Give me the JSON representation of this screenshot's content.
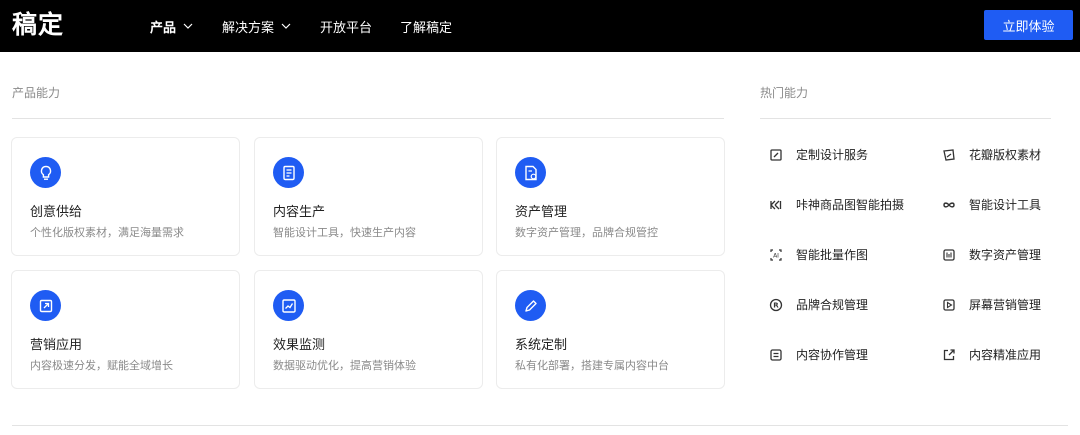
{
  "header": {
    "logo": "稿定",
    "nav": [
      {
        "label": "产品",
        "dropdown": true,
        "active": true
      },
      {
        "label": "解决方案",
        "dropdown": true,
        "active": false
      },
      {
        "label": "开放平台",
        "dropdown": false,
        "active": false
      },
      {
        "label": "了解稿定",
        "dropdown": false,
        "active": false
      }
    ],
    "cta_label": "立即体验"
  },
  "colors": {
    "brand": "#1f5cf3",
    "header_bg": "#000000"
  },
  "capabilities": {
    "title": "产品能力",
    "cards": [
      {
        "title": "创意供给",
        "desc": "个性化版权素材，满足海量需求",
        "icon": "lightbulb-icon"
      },
      {
        "title": "内容生产",
        "desc": "智能设计工具，快速生产内容",
        "icon": "document-icon"
      },
      {
        "title": "资产管理",
        "desc": "数字资产管理，品牌合规管控",
        "icon": "asset-file-icon"
      },
      {
        "title": "营销应用",
        "desc": "内容极速分发，赋能全域增长",
        "icon": "external-link-icon"
      },
      {
        "title": "效果监测",
        "desc": "数据驱动优化，提高营销体验",
        "icon": "trend-chart-icon"
      },
      {
        "title": "系统定制",
        "desc": "私有化部署，搭建专属内容中台",
        "icon": "pen-edit-icon"
      }
    ]
  },
  "hot": {
    "title": "热门能力",
    "items": [
      {
        "label": "定制设计服务",
        "icon": "custom-design-icon"
      },
      {
        "label": "花瓣版权素材",
        "icon": "petal-icon"
      },
      {
        "label": "咔神商品图智能拍摄",
        "icon": "camera-shoot-icon"
      },
      {
        "label": "智能设计工具",
        "icon": "infinity-icon"
      },
      {
        "label": "智能批量作图",
        "icon": "ai-batch-icon"
      },
      {
        "label": "数字资产管理",
        "icon": "digital-asset-icon"
      },
      {
        "label": "品牌合规管理",
        "icon": "registered-icon"
      },
      {
        "label": "屏幕营销管理",
        "icon": "screen-play-icon"
      },
      {
        "label": "内容协作管理",
        "icon": "collaboration-icon"
      },
      {
        "label": "内容精准应用",
        "icon": "share-out-icon"
      }
    ]
  }
}
